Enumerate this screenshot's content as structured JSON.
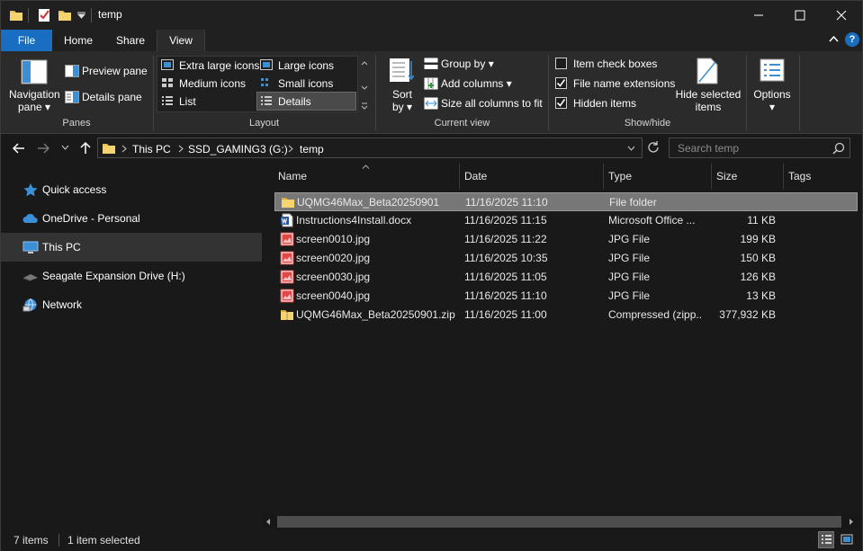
{
  "window": {
    "title": "temp"
  },
  "ribbon_tabs": {
    "file": "File",
    "home": "Home",
    "share": "Share",
    "view": "View"
  },
  "ribbon": {
    "panes": {
      "navigation_pane_line1": "Navigation",
      "navigation_pane_line2": "pane",
      "preview_pane": "Preview pane",
      "details_pane": "Details pane",
      "group_label": "Panes"
    },
    "layout": {
      "extra_large_icons": "Extra large icons",
      "large_icons": "Large icons",
      "medium_icons": "Medium icons",
      "small_icons": "Small icons",
      "list": "List",
      "details": "Details",
      "group_label": "Layout"
    },
    "current_view": {
      "sort_by_line1": "Sort",
      "sort_by_line2": "by",
      "group_by": "Group by",
      "add_columns": "Add columns",
      "size_all_columns": "Size all columns to fit",
      "group_label": "Current view"
    },
    "show_hide": {
      "item_check_boxes": "Item check boxes",
      "file_name_extensions": "File name extensions",
      "hidden_items": "Hidden items",
      "item_check_boxes_checked": false,
      "file_name_extensions_checked": true,
      "hidden_items_checked": true,
      "hide_selected_line1": "Hide selected",
      "hide_selected_line2": "items",
      "group_label": "Show/hide"
    },
    "options": {
      "label": "Options"
    }
  },
  "address": {
    "crumbs": [
      "This PC",
      "SSD_GAMING3 (G:)",
      "temp"
    ],
    "search_placeholder": "Search temp"
  },
  "nav": {
    "items": [
      {
        "label": "Quick access",
        "icon": "star-icon"
      },
      {
        "label": "OneDrive - Personal",
        "icon": "cloud-icon"
      },
      {
        "label": "This PC",
        "icon": "computer-icon",
        "selected": true
      },
      {
        "label": "Seagate Expansion Drive (H:)",
        "icon": "drive-icon"
      },
      {
        "label": "Network",
        "icon": "network-icon"
      }
    ]
  },
  "columns": {
    "name": "Name",
    "date": "Date",
    "type": "Type",
    "size": "Size",
    "tags": "Tags"
  },
  "files": [
    {
      "name": "UQMG46Max_Beta20250901",
      "date": "11/16/2025 11:10",
      "type": "File folder",
      "size": "",
      "icon": "folder-icon",
      "selected": true
    },
    {
      "name": "Instructions4Install.docx",
      "date": "11/16/2025 11:15",
      "type": "Microsoft Office ...",
      "size": "11 KB",
      "icon": "word-document-icon"
    },
    {
      "name": "screen0010.jpg",
      "date": "11/16/2025 11:22",
      "type": "JPG File",
      "size": "199 KB",
      "icon": "image-file-icon"
    },
    {
      "name": "screen0020.jpg",
      "date": "11/16/2025 10:35",
      "type": "JPG File",
      "size": "150 KB",
      "icon": "image-file-icon"
    },
    {
      "name": "screen0030.jpg",
      "date": "11/16/2025 11:05",
      "type": "JPG File",
      "size": "126 KB",
      "icon": "image-file-icon"
    },
    {
      "name": "screen0040.jpg",
      "date": "11/16/2025 11:10",
      "type": "JPG File",
      "size": "13 KB",
      "icon": "image-file-icon"
    },
    {
      "name": "UQMG46Max_Beta20250901.zip",
      "date": "11/16/2025 11:00",
      "type": "Compressed (zipp...",
      "size": "377,932 KB",
      "icon": "zip-folder-icon"
    }
  ],
  "status": {
    "items": "7 items",
    "selected": "1 item selected"
  },
  "colors": {
    "accent": "#1a6ec2",
    "folder": "#e8c15a",
    "background": "#191919",
    "ribbon": "#2b2b2b"
  }
}
